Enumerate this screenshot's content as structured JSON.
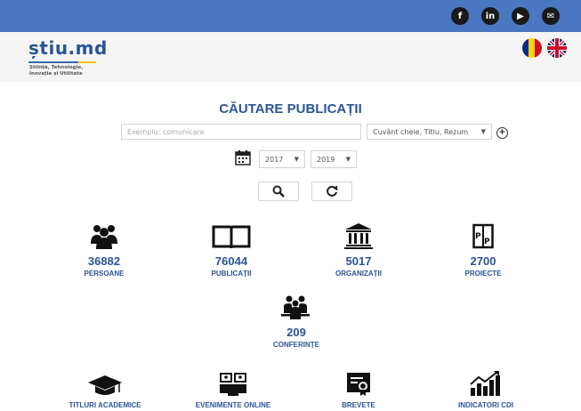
{
  "header": {
    "logo": "știu.md",
    "tagline": [
      "Știință, Tehnologie,",
      "Inovație și Utilitate"
    ],
    "social_icons": [
      "facebook-icon",
      "linkedin-icon",
      "youtube-icon",
      "mail-icon"
    ],
    "languages": [
      "ro",
      "en"
    ]
  },
  "search": {
    "title": "CĂUTARE PUBLICAȚII",
    "placeholder": "Exemplu: comunicare",
    "field_select": "Cuvânt cheie, Titlu, Rezum",
    "year_from": "2017",
    "year_to": "2019"
  },
  "stats": [
    {
      "number": "36882",
      "label": "PERSOANE"
    },
    {
      "number": "76044",
      "label": "PUBLICAȚII"
    },
    {
      "number": "5017",
      "label": "ORGANIZAȚII"
    },
    {
      "number": "2700",
      "label": "PROIECTE"
    },
    {
      "number": "209",
      "label": "CONFERINȚE"
    }
  ],
  "bottom": [
    "TITLURI ACADEMICE",
    "EVENIMENTE ONLINE",
    "BREVETE",
    "INDICATORI CDI"
  ],
  "colors": {
    "topbar": "#4a77c2",
    "accent": "#2b5594"
  }
}
